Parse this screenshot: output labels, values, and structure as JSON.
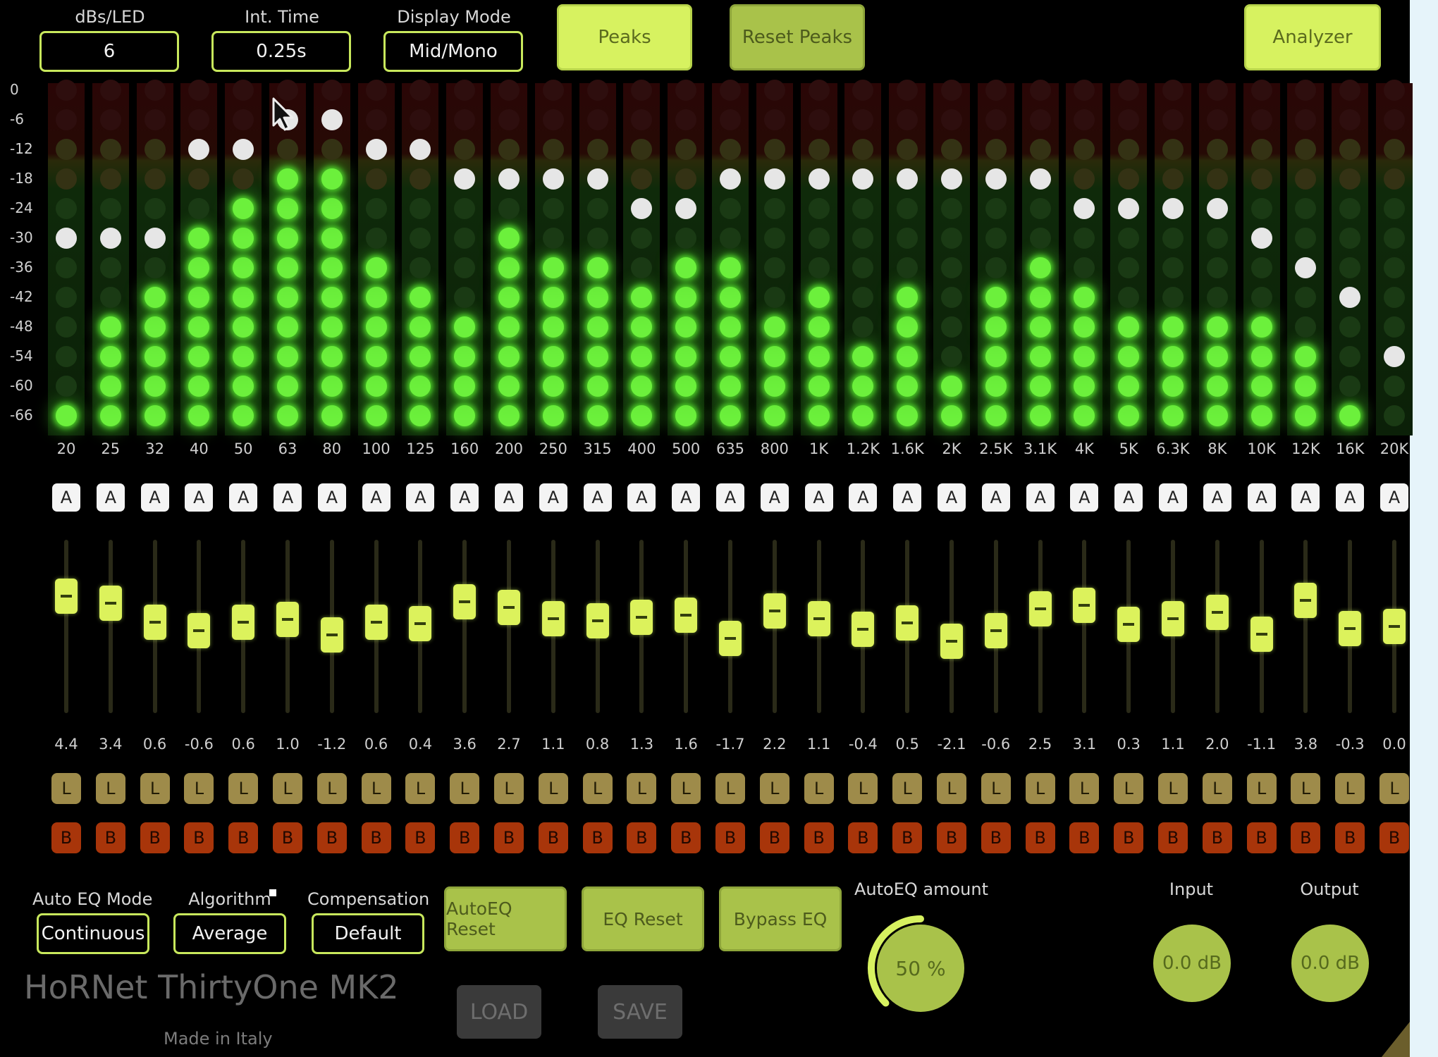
{
  "controls": {
    "dbs_per_led": {
      "label": "dBs/LED",
      "value": "6"
    },
    "int_time": {
      "label": "Int. Time",
      "value": "0.25s"
    },
    "display_mode": {
      "label": "Display Mode",
      "value": "Mid/Mono"
    },
    "peaks_label": "Peaks",
    "reset_peaks_label": "Reset Peaks",
    "analyzer_label": "Analyzer"
  },
  "meter": {
    "scale": [
      "0",
      "-6",
      "-12",
      "-18",
      "-24",
      "-30",
      "-36",
      "-42",
      "-48",
      "-54",
      "-60",
      "-66"
    ],
    "bands": [
      {
        "freq": "20",
        "level_leds": 1,
        "peak_led": 6
      },
      {
        "freq": "25",
        "level_leds": 4,
        "peak_led": 6
      },
      {
        "freq": "32",
        "level_leds": 5,
        "peak_led": 6
      },
      {
        "freq": "40",
        "level_leds": 7,
        "peak_led": 9
      },
      {
        "freq": "50",
        "level_leds": 8,
        "peak_led": 9
      },
      {
        "freq": "63",
        "level_leds": 9,
        "peak_led": 10
      },
      {
        "freq": "80",
        "level_leds": 9,
        "peak_led": 10
      },
      {
        "freq": "100",
        "level_leds": 6,
        "peak_led": 9
      },
      {
        "freq": "125",
        "level_leds": 5,
        "peak_led": 9
      },
      {
        "freq": "160",
        "level_leds": 4,
        "peak_led": 8
      },
      {
        "freq": "200",
        "level_leds": 7,
        "peak_led": 8
      },
      {
        "freq": "250",
        "level_leds": 6,
        "peak_led": 8
      },
      {
        "freq": "315",
        "level_leds": 6,
        "peak_led": 8
      },
      {
        "freq": "400",
        "level_leds": 5,
        "peak_led": 7
      },
      {
        "freq": "500",
        "level_leds": 6,
        "peak_led": 7
      },
      {
        "freq": "635",
        "level_leds": 6,
        "peak_led": 8
      },
      {
        "freq": "800",
        "level_leds": 4,
        "peak_led": 8
      },
      {
        "freq": "1K",
        "level_leds": 5,
        "peak_led": 8
      },
      {
        "freq": "1.2K",
        "level_leds": 3,
        "peak_led": 8
      },
      {
        "freq": "1.6K",
        "level_leds": 5,
        "peak_led": 8
      },
      {
        "freq": "2K",
        "level_leds": 2,
        "peak_led": 8
      },
      {
        "freq": "2.5K",
        "level_leds": 5,
        "peak_led": 8
      },
      {
        "freq": "3.1K",
        "level_leds": 6,
        "peak_led": 8
      },
      {
        "freq": "4K",
        "level_leds": 5,
        "peak_led": 7
      },
      {
        "freq": "5K",
        "level_leds": 4,
        "peak_led": 7
      },
      {
        "freq": "6.3K",
        "level_leds": 4,
        "peak_led": 7
      },
      {
        "freq": "8K",
        "level_leds": 4,
        "peak_led": 7
      },
      {
        "freq": "10K",
        "level_leds": 4,
        "peak_led": 6
      },
      {
        "freq": "12K",
        "level_leds": 3,
        "peak_led": 5
      },
      {
        "freq": "16K",
        "level_leds": 1,
        "peak_led": 4
      },
      {
        "freq": "20K",
        "level_leds": 0,
        "peak_led": 2
      }
    ]
  },
  "eq": {
    "auto_label": "A",
    "l_label": "L",
    "b_label": "B",
    "gain_range_db": [
      -12,
      12
    ],
    "gains": [
      "4.4",
      "3.4",
      "0.6",
      "-0.6",
      "0.6",
      "1.0",
      "-1.2",
      "0.6",
      "0.4",
      "3.6",
      "2.7",
      "1.1",
      "0.8",
      "1.3",
      "1.6",
      "-1.7",
      "2.2",
      "1.1",
      "-0.4",
      "0.5",
      "-2.1",
      "-0.6",
      "2.5",
      "3.1",
      "0.3",
      "1.1",
      "2.0",
      "-1.1",
      "3.8",
      "-0.3",
      "0.0"
    ]
  },
  "bottom": {
    "auto_eq_mode": {
      "label": "Auto EQ Mode",
      "value": "Continuous"
    },
    "algorithm": {
      "label": "Algorithm",
      "value": "Average"
    },
    "compensation": {
      "label": "Compensation",
      "value": "Default"
    },
    "autoeq_reset_label": "AutoEQ Reset",
    "eq_reset_label": "EQ Reset",
    "bypass_eq_label": "Bypass EQ",
    "autoeq_amount": {
      "label": "AutoEQ amount",
      "value": "50 %",
      "fraction": 0.5
    },
    "input": {
      "label": "Input",
      "value": "0.0 dB"
    },
    "output": {
      "label": "Output",
      "value": "0.0 dB"
    },
    "load_label": "LOAD",
    "save_label": "SAVE",
    "brand": "HoRNet ThirtyOne MK2",
    "made_in": "Made in Italy"
  },
  "colors": {
    "accent": "#d7f260",
    "led_on": "#6cf03c",
    "peak": "#e6e6e6",
    "l_button": "#9e8b4a",
    "b_button": "#a8350a"
  }
}
